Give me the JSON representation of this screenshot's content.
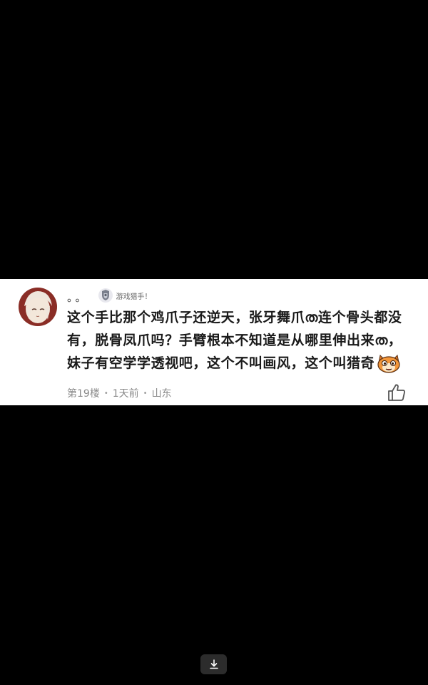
{
  "comment": {
    "username": "。。",
    "badge_label": "游戏猎手！",
    "body_text": "这个手比那个鸡爪子还逆天，张牙舞爪ത连个骨头都没有，脱骨凤爪吗？手臂根本不知道是从哪里伸出来ത，妹子有空学学透视吧，这个不叫画风，这个叫猎奇",
    "emoji_icon": "cat-face-emoji",
    "floor": "第19楼",
    "time": "1天前",
    "location": "山东",
    "separator": "•"
  },
  "icons": {
    "like": "thumbs-up-icon",
    "download": "download-icon",
    "badge": "game-hunter-badge-icon"
  },
  "colors": {
    "background": "#000000",
    "card": "#ffffff",
    "text": "#1a1a1a",
    "meta": "#8a8a8a"
  }
}
